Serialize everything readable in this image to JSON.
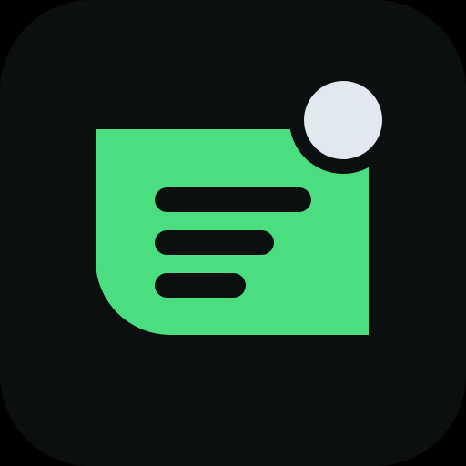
{
  "icon": {
    "name": "notes-notification-app-icon",
    "tile_color": "#0C0F0F",
    "note_color": "#4ADE80",
    "line_color": "#0C0F0F",
    "badge_color": "#E2E8F0",
    "badge_ring_color": "#0C0F0F",
    "note_line_count": 3,
    "has_notification_badge": true
  }
}
